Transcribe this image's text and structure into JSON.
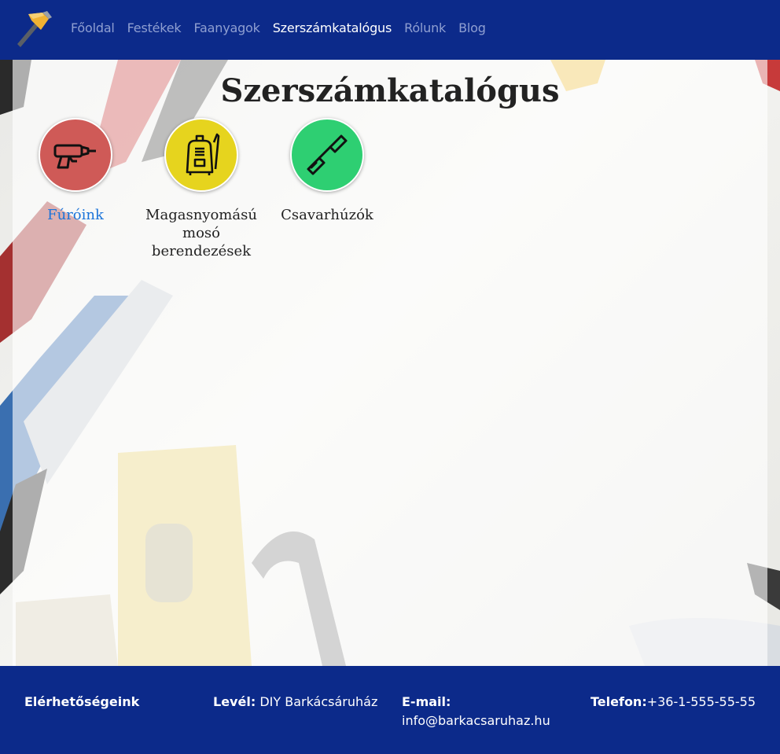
{
  "nav": {
    "items": [
      {
        "label": "Főoldal",
        "active": false
      },
      {
        "label": "Festékek",
        "active": false
      },
      {
        "label": "Faanyagok",
        "active": false
      },
      {
        "label": "Szerszámkatalógus",
        "active": true
      },
      {
        "label": "Rólunk",
        "active": false
      },
      {
        "label": "Blog",
        "active": false
      }
    ],
    "logo_icon": "hammer-icon"
  },
  "page": {
    "title": "Szerszámkatalógus"
  },
  "categories": [
    {
      "label": "Fúróink",
      "icon": "drill-icon",
      "color": "#cf5a57",
      "link": true
    },
    {
      "label_lines": [
        "Magasnyomású",
        "mosó",
        "berendezések"
      ],
      "icon": "pressure-washer-icon",
      "color": "#e6d41e",
      "link": false
    },
    {
      "label": "Csavarhúzók",
      "icon": "screwdriver-icon",
      "color": "#2ecf72",
      "link": false
    }
  ],
  "footer": {
    "contacts_title": "Elérhetőségeink",
    "mail_label": "Levél:",
    "mail_value": "DIY Barkácsáruház",
    "email_label": "E-mail:",
    "email_value": "info@barkacsaruhaz.hu",
    "phone_label": "Telefon:",
    "phone_value": "+36-1-555-55-55"
  },
  "colors": {
    "header_bg": "#0c2a8a",
    "nav_inactive": "#8f9fd1",
    "nav_active": "#ffffff",
    "link": "#1a73d9"
  }
}
